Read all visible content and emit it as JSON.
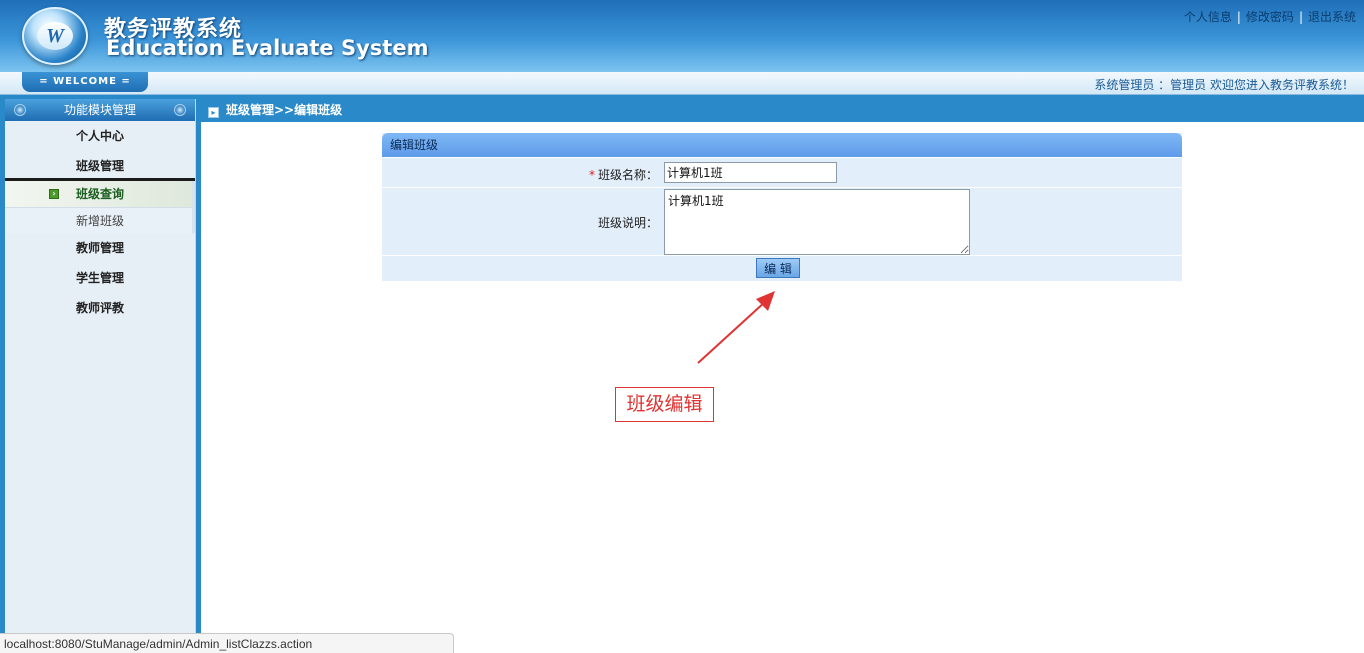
{
  "header": {
    "logo_letter": "W",
    "title_cn": "教务评教系统",
    "title_en": "Education Evaluate System",
    "links": [
      "个人信息",
      "修改密码",
      "退出系统"
    ],
    "link_separator": "|"
  },
  "welcome": {
    "tab_label": "= WELCOME =",
    "message": "系统管理员 ：管理员   欢迎您进入教务评教系统！"
  },
  "sidebar": {
    "title": "功能模块管理",
    "items": [
      {
        "label": "个人中心"
      },
      {
        "label": "班级管理",
        "open": true,
        "children": [
          {
            "label": "班级查询",
            "active": true
          },
          {
            "label": "新增班级"
          }
        ]
      },
      {
        "label": "教师管理"
      },
      {
        "label": "学生管理"
      },
      {
        "label": "教师评教"
      }
    ]
  },
  "breadcrumb": "班级管理>>编辑班级",
  "form": {
    "panel_title": "编辑班级",
    "required_mark": "*",
    "name_label": "班级名称：",
    "name_value": "计算机1班",
    "desc_label": "班级说明：",
    "desc_value": "计算机1班",
    "submit_label": "编 辑"
  },
  "annotation": {
    "label": "班级编辑",
    "color": "#e03333"
  },
  "status_bar": {
    "url": "localhost:8080/StuManage/admin/Admin_listClazzs.action"
  },
  "colors": {
    "header_blue": "#2a8ac9",
    "panel_head": "#6aa7e6",
    "panel_body": "#e2eef9"
  }
}
